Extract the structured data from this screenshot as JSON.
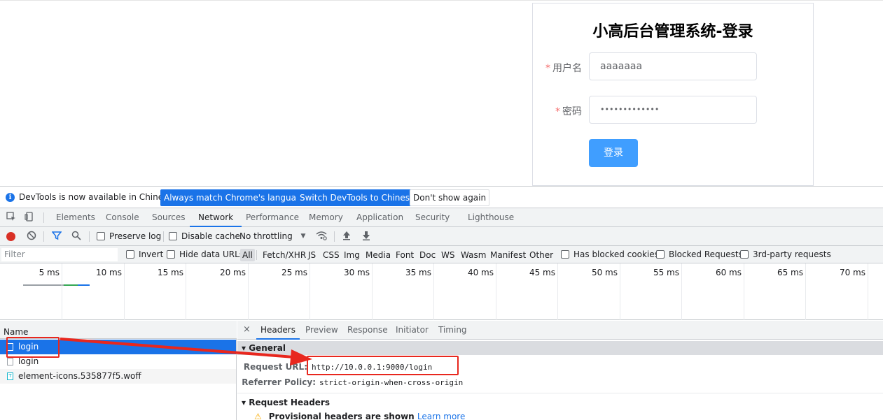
{
  "login": {
    "title": "小高后台管理系统-登录",
    "required_mark": "*",
    "username_label": "用户名",
    "username_value": "aaaaaaa",
    "password_label": "密码",
    "password_value": "•••••••••••••",
    "submit_label": "登录"
  },
  "infobar": {
    "icon": "i",
    "message": "DevTools is now available in Chinese!",
    "btn_match": "Always match Chrome's language",
    "btn_switch": "Switch DevTools to Chinese",
    "btn_dismiss": "Don't show again"
  },
  "tabs": {
    "items": [
      "Elements",
      "Console",
      "Sources",
      "Network",
      "Performance",
      "Memory",
      "Application",
      "Security",
      "Lighthouse"
    ],
    "active": "Network"
  },
  "toolbar": {
    "preserve_log": "Preserve log",
    "disable_cache": "Disable cache",
    "throttling": "No throttling"
  },
  "filterbar": {
    "placeholder": "Filter",
    "invert": "Invert",
    "hide_data_urls": "Hide data URLs",
    "types": [
      "All",
      "Fetch/XHR",
      "JS",
      "CSS",
      "Img",
      "Media",
      "Font",
      "Doc",
      "WS",
      "Wasm",
      "Manifest",
      "Other"
    ],
    "has_blocked_cookies": "Has blocked cookies",
    "blocked_requests": "Blocked Requests",
    "third_party": "3rd-party requests"
  },
  "overview": {
    "ticks": [
      "5 ms",
      "10 ms",
      "15 ms",
      "20 ms",
      "25 ms",
      "30 ms",
      "35 ms",
      "40 ms",
      "45 ms",
      "50 ms",
      "55 ms",
      "60 ms",
      "65 ms",
      "70 ms"
    ],
    "bar_colors": [
      "#9aa0a6",
      "#34a853",
      "#1a73e8"
    ]
  },
  "requests": {
    "header": "Name",
    "rows": [
      "login",
      "login",
      "element-icons.535877f5.woff"
    ]
  },
  "detail": {
    "close": "×",
    "tabs": [
      "Headers",
      "Preview",
      "Response",
      "Initiator",
      "Timing"
    ],
    "general_title": "▾ General",
    "request_url_key": "Request URL:",
    "request_url_val": "http://10.0.0.1:9000/login",
    "referrer_key": "Referrer Policy:",
    "referrer_val": "strict-origin-when-cross-origin",
    "request_headers_title": "▾ Request Headers",
    "provisional_text": "Provisional headers are shown",
    "learn_more": "Learn more"
  },
  "annotation_color": "#e8271e"
}
